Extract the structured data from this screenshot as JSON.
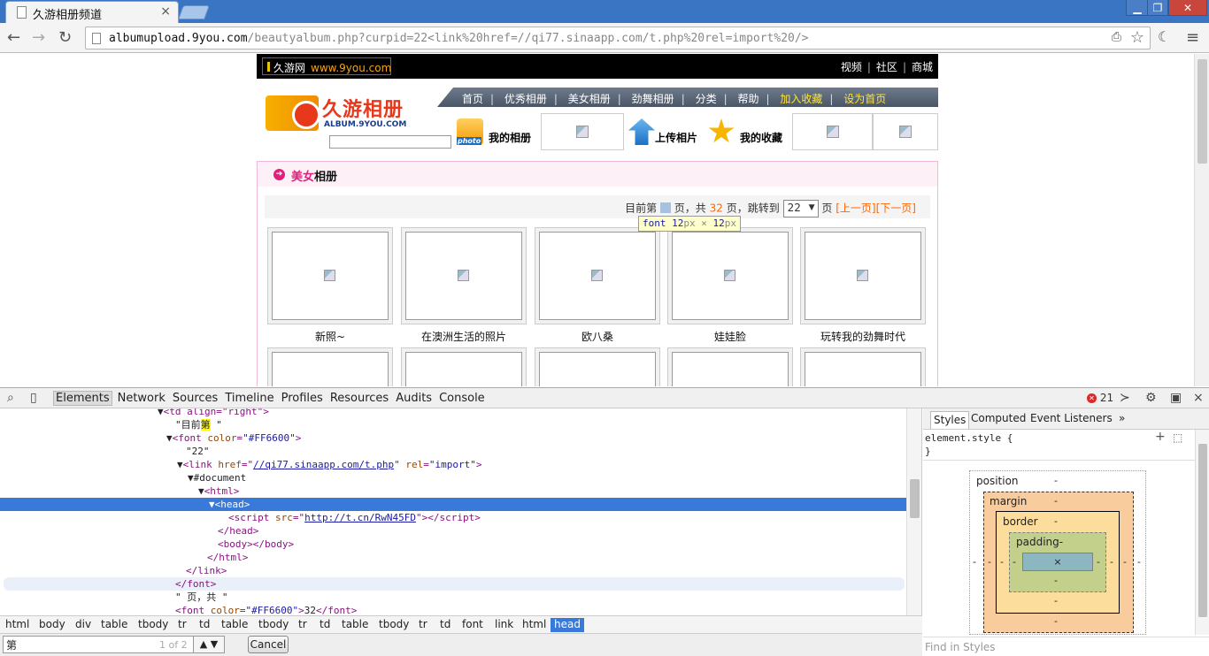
{
  "browser": {
    "tab_title": "久游相册频道",
    "tab_close": "×",
    "url_host": "albumupload.9you.com",
    "url_rest": "/beautyalbum.php?curpid=22<link%20href=//qi77.sinaapp.com/t.php%20rel=import%20/>",
    "win_minimize": "▁",
    "win_restore": "❐",
    "win_close": "✕",
    "back": "←",
    "forward": "→",
    "reload": "↻",
    "bookmark_star": "☆",
    "menu": "≡"
  },
  "site": {
    "brand_name": "久游网",
    "brand_url": "www.9you.com",
    "top_links": [
      "视频",
      "社区",
      "商城"
    ],
    "logo_name": "久游相册",
    "logo_sub": "ALBUM.9YOU.COM",
    "nav_items": [
      {
        "label": "首页",
        "highlight": false
      },
      {
        "label": "优秀相册",
        "highlight": false
      },
      {
        "label": "美女相册",
        "highlight": false
      },
      {
        "label": "劲舞相册",
        "highlight": false
      },
      {
        "label": "分类",
        "highlight": false
      },
      {
        "label": "帮助",
        "highlight": false
      },
      {
        "label": "加入收藏",
        "highlight": true
      },
      {
        "label": "设为首页",
        "highlight": true
      }
    ],
    "nav_sep": "|",
    "sub_buttons": {
      "my_album": "我的相册",
      "my_album_badge": "photo",
      "upload": "上传相片",
      "favorites": "我的收藏"
    },
    "section_title_pink": "美女",
    "section_title_rest": "相册",
    "pager": {
      "prefix": "目前第",
      "page_unit_total": "页，共",
      "total": "32",
      "jump": "页，跳转到",
      "select_value": "22",
      "suffix": "页",
      "prev": "[上一页]",
      "next": "[下一页]"
    },
    "tooltip": {
      "tag": "font",
      "w": "12",
      "h": "12"
    },
    "albums": [
      "新照~",
      "在澳洲生活的照片",
      "欧八桑",
      "娃娃脸",
      "玩转我的劲舞时代"
    ]
  },
  "devtools": {
    "tabs": [
      "Elements",
      "Network",
      "Sources",
      "Timeline",
      "Profiles",
      "Resources",
      "Audits",
      "Console"
    ],
    "active_tab": "Elements",
    "error_count": "21",
    "dom": {
      "l0": "<td align=\"right\">",
      "l1_pre": "\"目前",
      "l1_hit": "第",
      "l1_post": " \"",
      "font_open": "font",
      "font_attr": "color",
      "font_val": "\"#FF6600\"",
      "l3": "\"22\"",
      "link_tag": "link",
      "href_attr": "href",
      "href_val": "//qi77.sinaapp.com/t.php",
      "rel_attr": "rel",
      "rel_val": "\"import\"",
      "document": "#document",
      "html_tag": "html",
      "head_tag": "head",
      "script_tag": "script",
      "src_attr": "src",
      "src_val": "http://t.cn/RwN45FD",
      "body_tag": "body",
      "text_page": "\" 页，共 \"",
      "l15_val": "32"
    },
    "breadcrumbs": [
      "html",
      "body",
      "div",
      "table",
      "tbody",
      "tr",
      "td",
      "table",
      "tbody",
      "tr",
      "td",
      "table",
      "tbody",
      "tr",
      "td",
      "font",
      "link",
      "html",
      "head"
    ],
    "find_value": "第",
    "find_count": "1 of 2",
    "find_updown": "▲ ▼",
    "cancel": "Cancel",
    "side_tabs": [
      "Styles",
      "Computed",
      "Event Listeners"
    ],
    "side_more": "»",
    "element_style": "element.style {",
    "close_brace": "}",
    "find_styles": "Find in Styles",
    "boxmodel": {
      "position": "position",
      "margin": "margin",
      "border": "border",
      "padding": "padding-",
      "dash": "-",
      "content": "×"
    }
  }
}
